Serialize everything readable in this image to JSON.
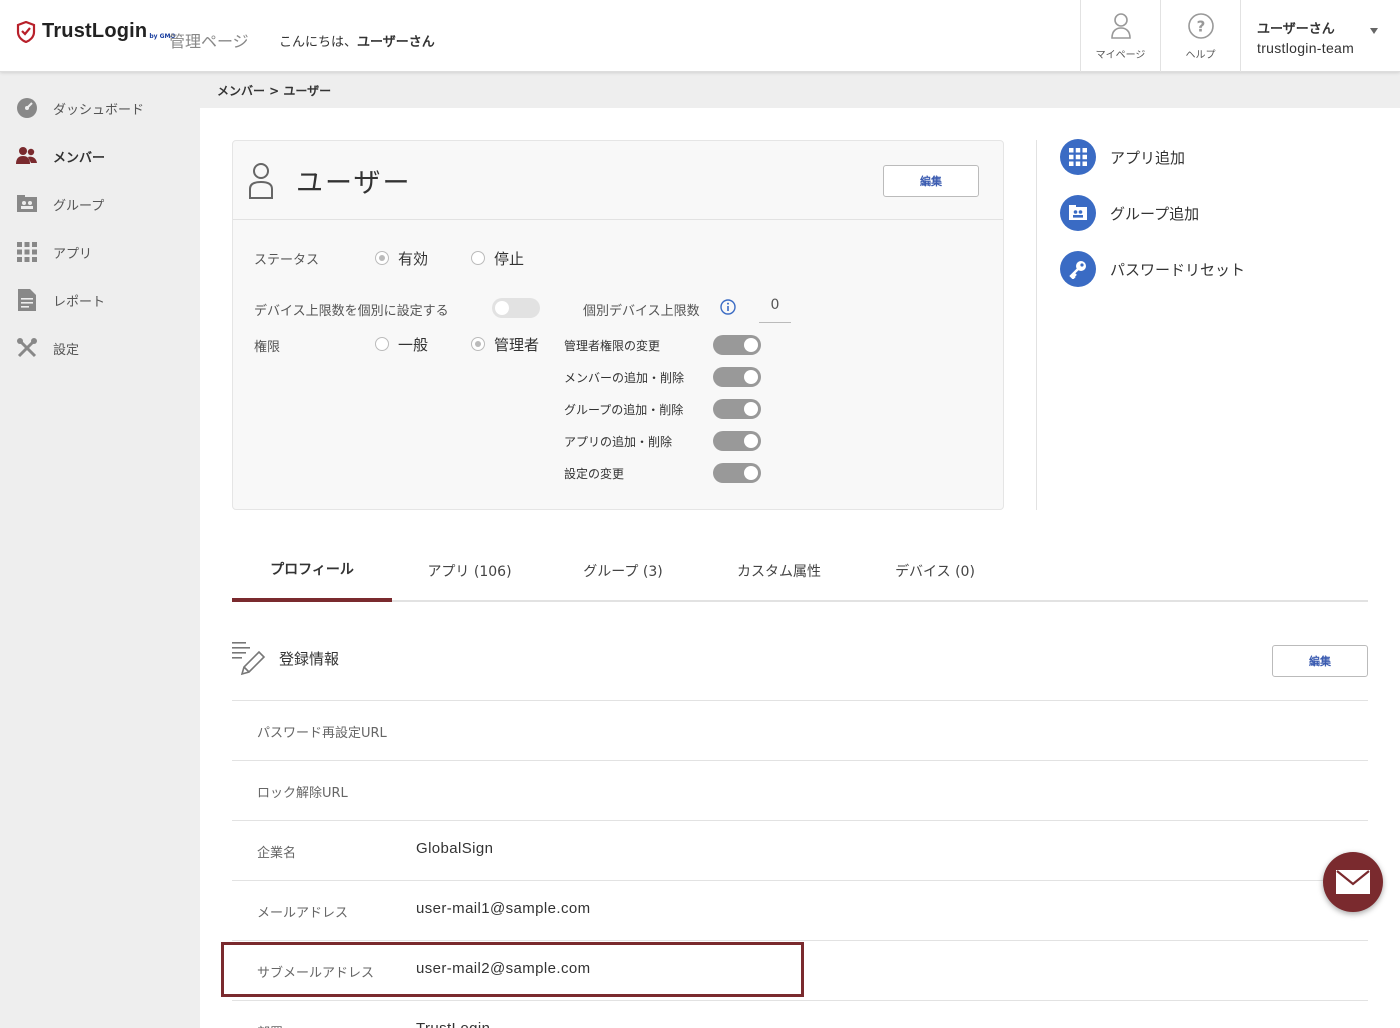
{
  "header": {
    "logo_text": "TrustLogin",
    "logo_sub": "by GMO",
    "admin_label": "管理ページ",
    "greeting_prefix": "こんにちは、",
    "greeting_name": "ユーザーさん",
    "mypage_label": "マイページ",
    "help_label": "ヘルプ",
    "user_name": "ユーザーさん",
    "user_team": "trustlogin-team"
  },
  "sidebar": {
    "items": [
      {
        "label": "ダッシュボード",
        "icon": "dashboard-icon"
      },
      {
        "label": "メンバー",
        "icon": "members-icon",
        "active": true
      },
      {
        "label": "グループ",
        "icon": "group-icon"
      },
      {
        "label": "アプリ",
        "icon": "apps-grid-icon"
      },
      {
        "label": "レポート",
        "icon": "report-icon"
      },
      {
        "label": "設定",
        "icon": "settings-tools-icon"
      }
    ]
  },
  "breadcrumb": "メンバー > ユーザー",
  "card": {
    "title": "ユーザー",
    "edit_label": "編集",
    "status_label": "ステータス",
    "status_active": "有効",
    "status_stopped": "停止",
    "device_limit_label": "デバイス上限数を個別に設定する",
    "individual_limit_label": "個別デバイス上限数",
    "individual_limit_value": "0",
    "role_label": "権限",
    "role_general": "一般",
    "role_admin": "管理者",
    "permissions": [
      "管理者権限の変更",
      "メンバーの追加・削除",
      "グループの追加・削除",
      "アプリの追加・削除",
      "設定の変更"
    ]
  },
  "actions": [
    {
      "label": "アプリ追加",
      "icon": "apps-grid-icon"
    },
    {
      "label": "グループ追加",
      "icon": "group-add-icon"
    },
    {
      "label": "パスワードリセット",
      "icon": "key-icon"
    }
  ],
  "tabs": [
    {
      "label": "プロフィール",
      "active": true
    },
    {
      "label": "アプリ (106)"
    },
    {
      "label": "グループ (3)"
    },
    {
      "label": "カスタム属性"
    },
    {
      "label": "デバイス (0)"
    }
  ],
  "registration": {
    "title": "登録情報",
    "edit_label": "編集",
    "rows": [
      {
        "key": "パスワード再設定URL",
        "value": ""
      },
      {
        "key": "ロック解除URL",
        "value": ""
      },
      {
        "key": "企業名",
        "value": "GlobalSign"
      },
      {
        "key": "メールアドレス",
        "value": "user-mail1@sample.com"
      },
      {
        "key": "サブメールアドレス",
        "value": "user-mail2@sample.com"
      },
      {
        "key": "部署",
        "value": "TrustLogin"
      }
    ]
  },
  "colors": {
    "brand": "#7a2a2e",
    "accent_blue": "#3a6bc4"
  }
}
